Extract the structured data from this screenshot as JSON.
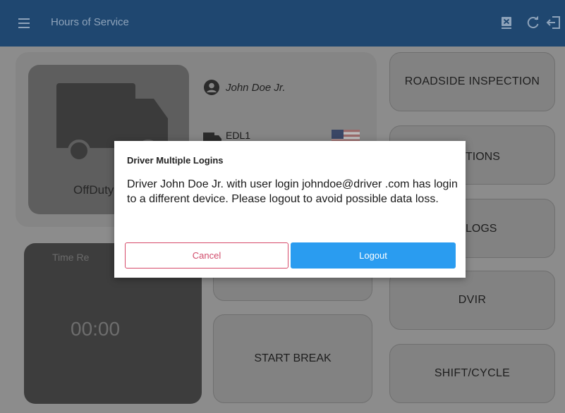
{
  "appbar": {
    "title": "Hours of Service",
    "actions": [
      {
        "icon": "close-box-icon"
      },
      {
        "icon": "refresh-icon"
      },
      {
        "icon": "logout-icon"
      }
    ]
  },
  "driver": {
    "name": "John Doe Jr.",
    "eld": "EDL1",
    "status": "OffDuty",
    "flag": "us-flag-icon"
  },
  "timer": {
    "label": "Time Re",
    "value": "00:00"
  },
  "right_menu": [
    "ROADSIDE INSPECTION",
    "TIONS",
    "LOGS",
    "DVIR",
    "SHIFT/CYCLE"
  ],
  "middle": {
    "start_break": "START BREAK"
  },
  "dialog": {
    "title": "Driver Multiple Logins",
    "message": "Driver John Doe Jr. with user login johndoe@driver .com has login to a different device. Please logout to avoid possible data loss.",
    "cancel": "Cancel",
    "logout": "Logout"
  },
  "colors": {
    "appbar": "#1f4770",
    "logout_button": "#2a9cf0",
    "cancel_border": "#d64a6a"
  }
}
